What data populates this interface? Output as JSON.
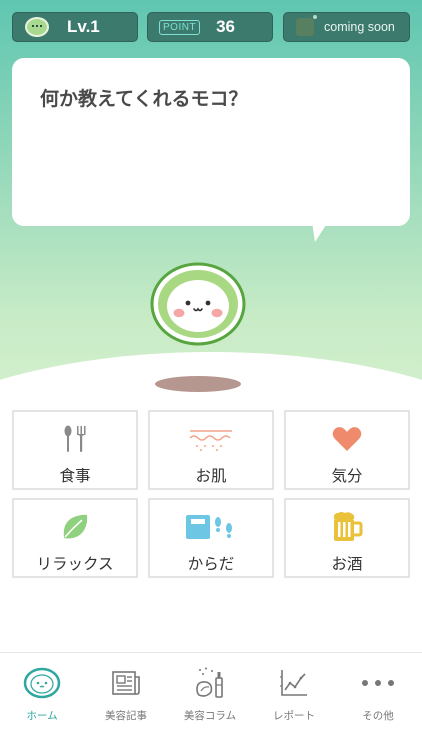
{
  "status": {
    "level_text": "Lv.1",
    "point_badge": "POINT",
    "point_value": "36",
    "coming_soon": "coming soon"
  },
  "bubble": {
    "question": "何か教えてくれるモコ？"
  },
  "categories": [
    {
      "label": "食事",
      "icon": "fork-knife-icon"
    },
    {
      "label": "お肌",
      "icon": "skin-icon"
    },
    {
      "label": "気分",
      "icon": "heart-icon"
    },
    {
      "label": "リラックス",
      "icon": "leaf-icon"
    },
    {
      "label": "からだ",
      "icon": "scale-footprints-icon"
    },
    {
      "label": "お酒",
      "icon": "beer-icon"
    }
  ],
  "tabs": [
    {
      "label": "ホーム",
      "icon": "mascot-face-icon",
      "active": true
    },
    {
      "label": "美容記事",
      "icon": "newspaper-icon",
      "active": false
    },
    {
      "label": "美容コラム",
      "icon": "cosmetics-icon",
      "active": false
    },
    {
      "label": "レポート",
      "icon": "chart-icon",
      "active": false
    },
    {
      "label": "その他",
      "icon": "more-dots-icon",
      "active": false
    }
  ],
  "colors": {
    "teal_top": "#5fc6b1",
    "mint_bottom": "#d8f1cf",
    "stat_bg": "#3c7a6e",
    "active_tab": "#2ea7a0",
    "heart": "#f08a6c",
    "leaf": "#8fd17e",
    "beer": "#e9c23a",
    "scale": "#6cc6e4"
  }
}
